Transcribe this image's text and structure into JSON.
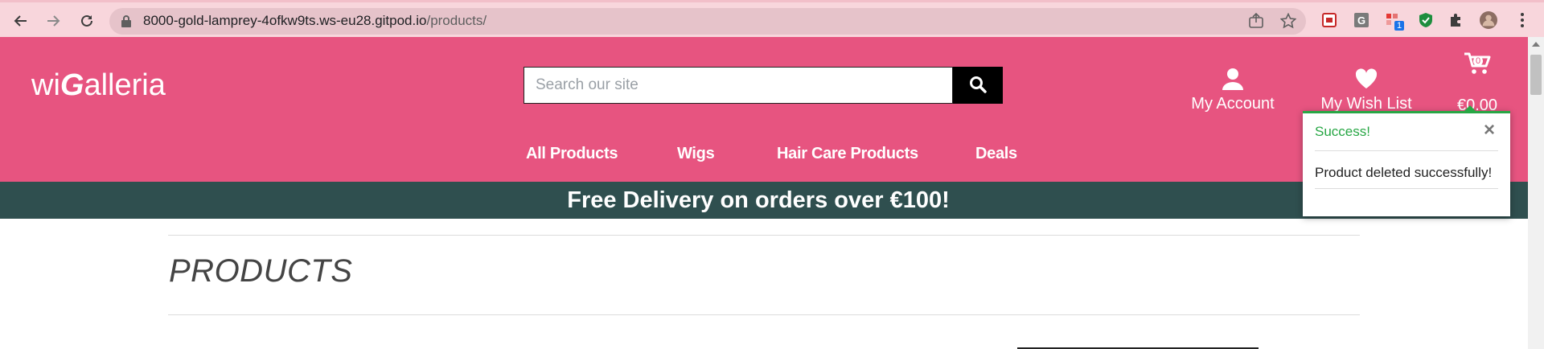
{
  "browser": {
    "url_host": "8000-gold-lamprey-4ofkw9ts.ws-eu28.gitpod.io",
    "url_path": "/products/",
    "ext_badge": "1",
    "icons": [
      "back-arrow-icon",
      "forward-arrow-icon",
      "reload-icon",
      "lock-icon",
      "share-icon",
      "star-icon",
      "extension-icon",
      "puzzle-icon",
      "profile-avatar",
      "menu-kebab-icon"
    ]
  },
  "site": {
    "logo_prefix": "wi",
    "logo_g": "G",
    "logo_suffix": "alleria",
    "search_placeholder": "Search our site",
    "account_label": "My Account",
    "wishlist_label": "My Wish List",
    "cart_total": "€0.00",
    "cart_count": "0",
    "nav": [
      "All Products",
      "Wigs",
      "Hair Care Products",
      "Deals"
    ],
    "banner": "Free Delivery on orders over €100!",
    "page_title": "PRODUCTS"
  },
  "toast": {
    "title": "Success!",
    "close": "×",
    "message": "Product deleted successfully!"
  },
  "colors": {
    "brand_pink": "#e75480",
    "banner_bg": "#2f4f4f",
    "success": "#28a745"
  }
}
